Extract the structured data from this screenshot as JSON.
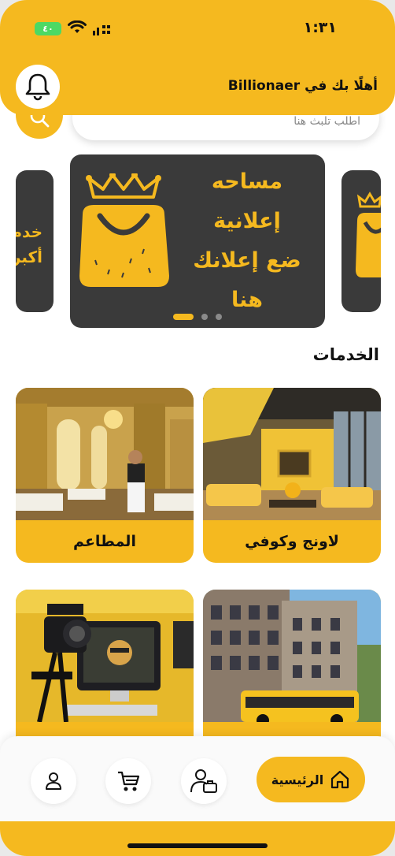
{
  "status_bar": {
    "time": "١:٣١",
    "battery": "٤٠"
  },
  "header": {
    "greeting": "أهلًا بك في Billionaer"
  },
  "search": {
    "placeholder": "اطلب تلبث هنا"
  },
  "banner": {
    "lines": [
      "مساحه",
      "إعلانية",
      "ضع إعلانك",
      "هنا"
    ],
    "left_peek_lines": [
      "خدم",
      "أكبر"
    ],
    "slide_count": 3,
    "active_slide": 1
  },
  "services": {
    "title": "الخدمات",
    "items": [
      {
        "label": "لاونج وكوفي"
      },
      {
        "label": "المطاعم"
      },
      {
        "label": ""
      },
      {
        "label": ""
      }
    ]
  },
  "bottom_nav": {
    "home_label": "الرئيسية",
    "items": [
      "home-icon",
      "suitcase-person-icon",
      "cart-icon",
      "person-icon"
    ]
  },
  "colors": {
    "accent": "#f5b91f",
    "banner_bg": "#3a3a3a"
  }
}
